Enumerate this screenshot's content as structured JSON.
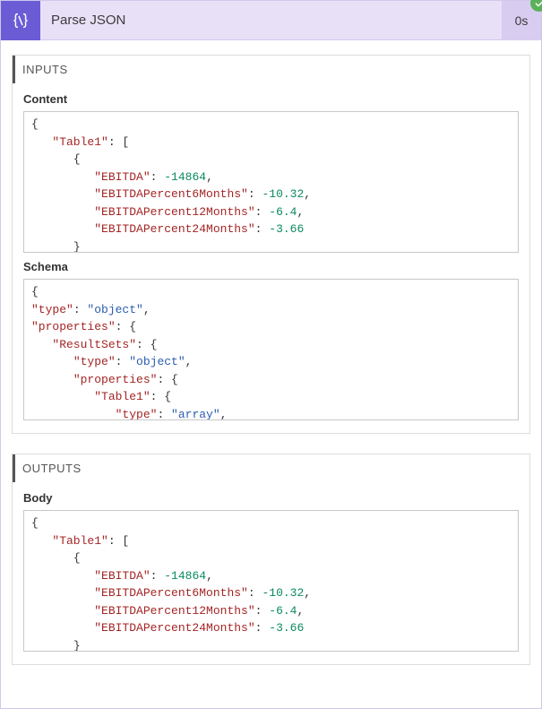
{
  "header": {
    "title": "Parse JSON",
    "duration": "0s",
    "icon_name": "parse-json-icon",
    "status": "success"
  },
  "sections": {
    "inputs": {
      "label": "INPUTS",
      "fields": {
        "content": {
          "label": "Content",
          "tokens": [
            {
              "t": "brace",
              "v": "{"
            },
            {
              "t": "nl"
            },
            {
              "t": "ind",
              "v": 1
            },
            {
              "t": "key",
              "v": "\"Table1\""
            },
            {
              "t": "plain",
              "v": ": ["
            },
            {
              "t": "nl"
            },
            {
              "t": "ind",
              "v": 2
            },
            {
              "t": "brace",
              "v": "{"
            },
            {
              "t": "nl"
            },
            {
              "t": "ind",
              "v": 3
            },
            {
              "t": "key",
              "v": "\"EBITDA\""
            },
            {
              "t": "plain",
              "v": ": "
            },
            {
              "t": "num",
              "v": "-14864"
            },
            {
              "t": "plain",
              "v": ","
            },
            {
              "t": "nl"
            },
            {
              "t": "ind",
              "v": 3
            },
            {
              "t": "key",
              "v": "\"EBITDAPercent6Months\""
            },
            {
              "t": "plain",
              "v": ": "
            },
            {
              "t": "num",
              "v": "-10.32"
            },
            {
              "t": "plain",
              "v": ","
            },
            {
              "t": "nl"
            },
            {
              "t": "ind",
              "v": 3
            },
            {
              "t": "key",
              "v": "\"EBITDAPercent12Months\""
            },
            {
              "t": "plain",
              "v": ": "
            },
            {
              "t": "num",
              "v": "-6.4"
            },
            {
              "t": "plain",
              "v": ","
            },
            {
              "t": "nl"
            },
            {
              "t": "ind",
              "v": 3
            },
            {
              "t": "key",
              "v": "\"EBITDAPercent24Months\""
            },
            {
              "t": "plain",
              "v": ": "
            },
            {
              "t": "num",
              "v": "-3.66"
            },
            {
              "t": "nl"
            },
            {
              "t": "ind",
              "v": 2
            },
            {
              "t": "brace",
              "v": "}"
            }
          ]
        },
        "schema": {
          "label": "Schema",
          "tokens": [
            {
              "t": "brace",
              "v": "{"
            },
            {
              "t": "nl"
            },
            {
              "t": "key",
              "v": "\"type\""
            },
            {
              "t": "plain",
              "v": ": "
            },
            {
              "t": "str",
              "v": "\"object\""
            },
            {
              "t": "plain",
              "v": ","
            },
            {
              "t": "nl"
            },
            {
              "t": "key",
              "v": "\"properties\""
            },
            {
              "t": "plain",
              "v": ": {"
            },
            {
              "t": "nl"
            },
            {
              "t": "ind",
              "v": 1
            },
            {
              "t": "key",
              "v": "\"ResultSets\""
            },
            {
              "t": "plain",
              "v": ": {"
            },
            {
              "t": "nl"
            },
            {
              "t": "ind",
              "v": 2
            },
            {
              "t": "key",
              "v": "\"type\""
            },
            {
              "t": "plain",
              "v": ": "
            },
            {
              "t": "str",
              "v": "\"object\""
            },
            {
              "t": "plain",
              "v": ","
            },
            {
              "t": "nl"
            },
            {
              "t": "ind",
              "v": 2
            },
            {
              "t": "key",
              "v": "\"properties\""
            },
            {
              "t": "plain",
              "v": ": {"
            },
            {
              "t": "nl"
            },
            {
              "t": "ind",
              "v": 3
            },
            {
              "t": "key",
              "v": "\"Table1\""
            },
            {
              "t": "plain",
              "v": ": {"
            },
            {
              "t": "nl"
            },
            {
              "t": "ind",
              "v": 4
            },
            {
              "t": "key",
              "v": "\"type\""
            },
            {
              "t": "plain",
              "v": ": "
            },
            {
              "t": "str",
              "v": "\"array\""
            },
            {
              "t": "plain",
              "v": ","
            }
          ]
        }
      }
    },
    "outputs": {
      "label": "OUTPUTS",
      "fields": {
        "body": {
          "label": "Body",
          "tokens": [
            {
              "t": "brace",
              "v": "{"
            },
            {
              "t": "nl"
            },
            {
              "t": "ind",
              "v": 1
            },
            {
              "t": "key",
              "v": "\"Table1\""
            },
            {
              "t": "plain",
              "v": ": ["
            },
            {
              "t": "nl"
            },
            {
              "t": "ind",
              "v": 2
            },
            {
              "t": "brace",
              "v": "{"
            },
            {
              "t": "nl"
            },
            {
              "t": "ind",
              "v": 3
            },
            {
              "t": "key",
              "v": "\"EBITDA\""
            },
            {
              "t": "plain",
              "v": ": "
            },
            {
              "t": "num",
              "v": "-14864"
            },
            {
              "t": "plain",
              "v": ","
            },
            {
              "t": "nl"
            },
            {
              "t": "ind",
              "v": 3
            },
            {
              "t": "key",
              "v": "\"EBITDAPercent6Months\""
            },
            {
              "t": "plain",
              "v": ": "
            },
            {
              "t": "num",
              "v": "-10.32"
            },
            {
              "t": "plain",
              "v": ","
            },
            {
              "t": "nl"
            },
            {
              "t": "ind",
              "v": 3
            },
            {
              "t": "key",
              "v": "\"EBITDAPercent12Months\""
            },
            {
              "t": "plain",
              "v": ": "
            },
            {
              "t": "num",
              "v": "-6.4"
            },
            {
              "t": "plain",
              "v": ","
            },
            {
              "t": "nl"
            },
            {
              "t": "ind",
              "v": 3
            },
            {
              "t": "key",
              "v": "\"EBITDAPercent24Months\""
            },
            {
              "t": "plain",
              "v": ": "
            },
            {
              "t": "num",
              "v": "-3.66"
            },
            {
              "t": "nl"
            },
            {
              "t": "ind",
              "v": 2
            },
            {
              "t": "brace",
              "v": "}"
            }
          ]
        }
      }
    }
  }
}
